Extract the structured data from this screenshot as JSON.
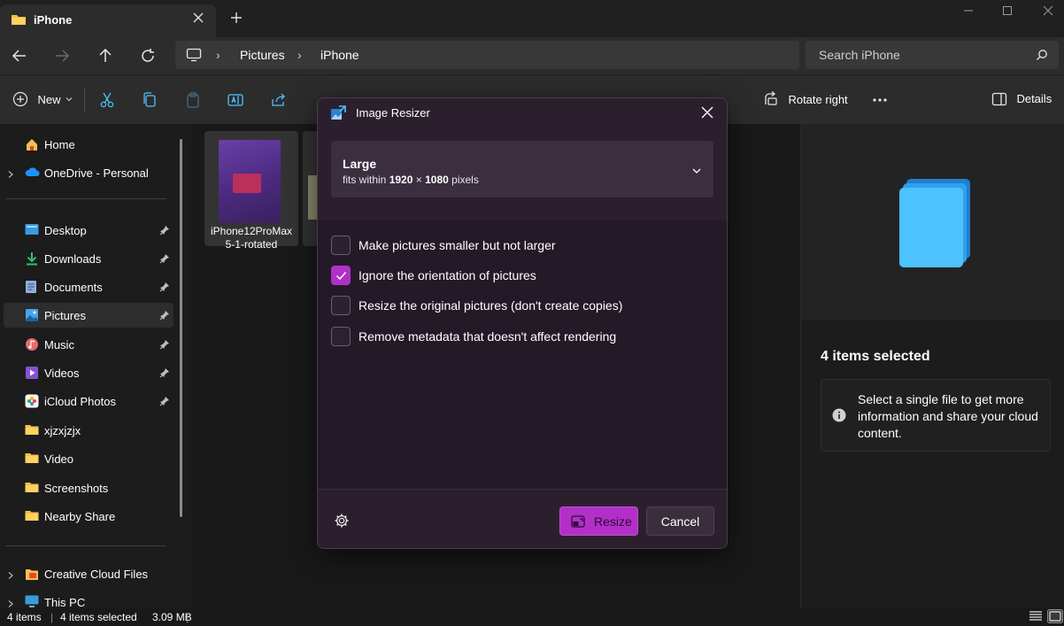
{
  "window": {
    "tab_title": "iPhone"
  },
  "address": {
    "crumbs": [
      "Pictures",
      "iPhone"
    ],
    "search_placeholder": "Search iPhone"
  },
  "toolbar": {
    "new_label": "New",
    "rotate_right_label": "Rotate right",
    "details_label": "Details"
  },
  "sidebar": {
    "items": [
      {
        "label": "Home",
        "icon": "home-icon"
      },
      {
        "label": "OneDrive - Personal",
        "icon": "cloud-icon"
      },
      {
        "label": "Desktop",
        "icon": "desktop-icon",
        "pinned": true
      },
      {
        "label": "Downloads",
        "icon": "download-icon",
        "pinned": true
      },
      {
        "label": "Documents",
        "icon": "documents-icon",
        "pinned": true
      },
      {
        "label": "Pictures",
        "icon": "pictures-icon",
        "pinned": true,
        "selected": true
      },
      {
        "label": "Music",
        "icon": "music-icon",
        "pinned": true
      },
      {
        "label": "Videos",
        "icon": "videos-icon",
        "pinned": true
      },
      {
        "label": "iCloud Photos",
        "icon": "icloud-photos-icon",
        "pinned": true
      },
      {
        "label": "xjzxjzjx",
        "icon": "folder-icon"
      },
      {
        "label": "Video",
        "icon": "folder-icon"
      },
      {
        "label": "Screenshots",
        "icon": "folder-icon"
      },
      {
        "label": "Nearby Share",
        "icon": "folder-icon"
      },
      {
        "label": "Creative Cloud Files",
        "icon": "creative-cloud-icon"
      },
      {
        "label": "This PC",
        "icon": "this-pc-icon"
      }
    ]
  },
  "files": [
    {
      "caption_line1": "iPhone12ProMax",
      "caption_line2": "5-1-rotated"
    }
  ],
  "details": {
    "selected_count": "4 items selected",
    "info_text": "Select a single file to get more information and share your cloud content."
  },
  "status": {
    "items": "4 items",
    "selected": "4 items selected",
    "size": "3.09 MB"
  },
  "dialog": {
    "title": "Image Resizer",
    "size_name": "Large",
    "size_prefix": "fits within",
    "size_width": "1920",
    "size_x": "×",
    "size_height": "1080",
    "size_unit": "pixels",
    "options": [
      {
        "label": "Make pictures smaller but not larger",
        "checked": false
      },
      {
        "label": "Ignore the orientation of pictures",
        "checked": true
      },
      {
        "label": "Resize the original pictures (don't create copies)",
        "checked": false
      },
      {
        "label": "Remove metadata that doesn't affect rendering",
        "checked": false
      }
    ],
    "resize_label": "Resize",
    "cancel_label": "Cancel"
  },
  "colors": {
    "accent": "#b230c8",
    "folder": "#f2c14b",
    "dialog_bg": "#2b1f2e"
  }
}
